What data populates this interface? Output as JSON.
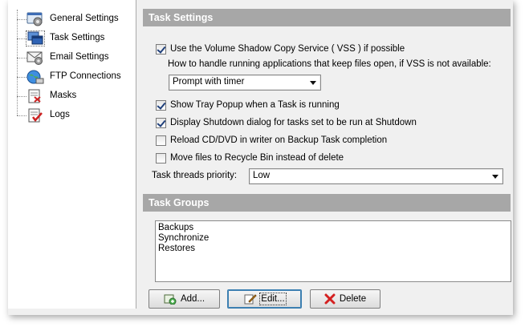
{
  "tree": {
    "items": [
      {
        "label": "General Settings",
        "icon": "general-settings-icon"
      },
      {
        "label": "Task Settings",
        "icon": "task-settings-icon"
      },
      {
        "label": "Email Settings",
        "icon": "email-settings-icon"
      },
      {
        "label": "FTP Connections",
        "icon": "ftp-connections-icon"
      },
      {
        "label": "Masks",
        "icon": "masks-icon"
      },
      {
        "label": "Logs",
        "icon": "logs-icon"
      }
    ],
    "selected_index": 1
  },
  "task_settings": {
    "header": "Task Settings",
    "use_vss": {
      "label": "Use the Volume Shadow Copy Service ( VSS ) if possible",
      "checked": true
    },
    "vss_hint": "How to handle running applications that keep files open, if VSS is not available:",
    "vss_fallback": {
      "value": "Prompt with timer"
    },
    "show_tray_popup": {
      "label": "Show Tray Popup when a Task is running",
      "checked": true
    },
    "shutdown_dialog": {
      "label": "Display Shutdown dialog for tasks set to be run at Shutdown",
      "checked": true
    },
    "reload_cd": {
      "label": "Reload CD/DVD in writer on Backup Task completion",
      "checked": false
    },
    "recycle_bin": {
      "label": "Move files to Recycle Bin instead of delete",
      "checked": false
    },
    "threads_priority_label": "Task threads priority:",
    "threads_priority": {
      "value": "Low"
    }
  },
  "task_groups": {
    "header": "Task Groups",
    "items": [
      "Backups",
      "Synchronize",
      "Restores"
    ],
    "add_label": "Add...",
    "edit_label": "Edit...",
    "delete_label": "Delete"
  },
  "colors": {
    "panel_header_bg": "#a7a7a7",
    "window_bg": "#f0f0f0",
    "checkmark": "#1f3f7a",
    "delete_icon": "#d42020"
  }
}
